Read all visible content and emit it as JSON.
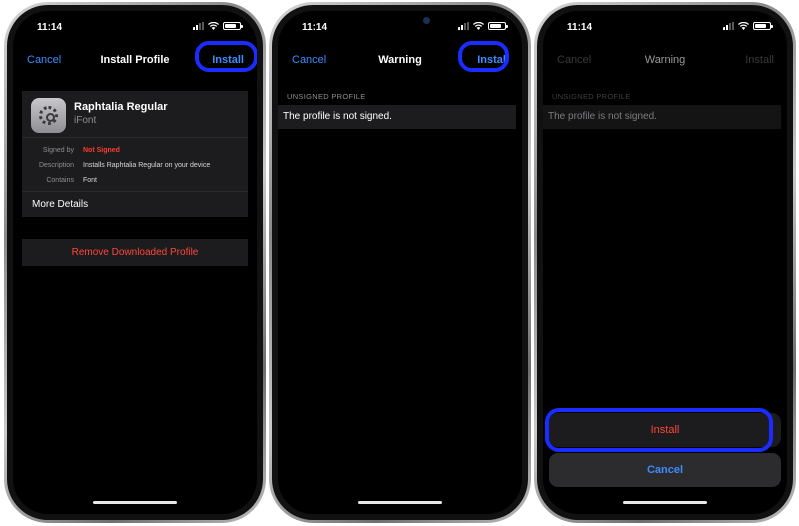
{
  "phones": [
    {
      "time": "11:14",
      "nav": {
        "left": "Cancel",
        "title": "Install Profile",
        "right": "Install"
      },
      "profile": {
        "name": "Raphtalia Regular",
        "source": "iFont"
      },
      "details": [
        {
          "key": "Signed by",
          "value": "Not Signed"
        },
        {
          "key": "Description",
          "value": "Installs Raphtalia Regular on your device"
        },
        {
          "key": "Contains",
          "value": "Font"
        }
      ],
      "more_details": "More Details",
      "remove_button": "Remove Downloaded Profile"
    },
    {
      "time": "11:14",
      "nav": {
        "left": "Cancel",
        "title": "Warning",
        "right": "Install"
      },
      "section_label": "UNSIGNED PROFILE",
      "message": "The profile is not signed."
    },
    {
      "time": "11:14",
      "nav": {
        "left": "Cancel",
        "title": "Warning",
        "right": "Install"
      },
      "section_label": "UNSIGNED PROFILE",
      "message": "The profile is not signed.",
      "action_sheet": {
        "install": "Install",
        "cancel": "Cancel"
      }
    }
  ],
  "colors": {
    "link": "#3b8cff",
    "destructive": "#ff453a",
    "highlight": "#1a2cff"
  },
  "icons": [
    "signal-icon",
    "wifi-icon",
    "battery-icon",
    "settings-gear-icon",
    "chevron-right-icon"
  ]
}
